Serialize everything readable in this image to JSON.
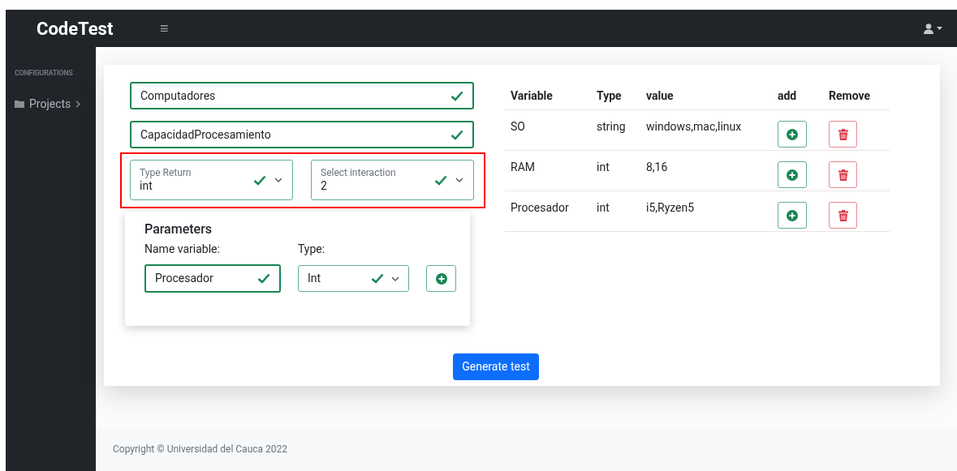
{
  "navbar": {
    "brand": "CodeTest",
    "menu_glyph": "≡"
  },
  "sidebar": {
    "heading": "CONFIGURATIONS",
    "items": [
      {
        "label": "Projects",
        "expanded": false
      }
    ]
  },
  "form": {
    "fields": [
      {
        "value": "Computadores",
        "valid": true
      },
      {
        "value": "CapacidadProcesamiento",
        "valid": true
      }
    ],
    "selects": [
      {
        "label": "Type Return",
        "value": "int",
        "valid": true
      },
      {
        "label": "Select interaction",
        "value": "2",
        "valid": true
      }
    ],
    "parameters": {
      "title": "Parameters",
      "name_label": "Name variable:",
      "type_label": "Type:",
      "name_value": "Procesador",
      "name_valid": true,
      "type_value": "Int",
      "type_valid": true
    }
  },
  "table": {
    "columns": [
      "Variable",
      "Type",
      "value",
      "add",
      "Remove"
    ],
    "rows": [
      {
        "variable": "SO",
        "type": "string",
        "value": "windows,mac,linux"
      },
      {
        "variable": "RAM",
        "type": "int",
        "value": "8,16"
      },
      {
        "variable": "Procesador",
        "type": "int",
        "value": "i5,Ryzen5"
      }
    ]
  },
  "generate_button": "Generate test",
  "footer": "Copyright © Universidad del Cauca 2022"
}
